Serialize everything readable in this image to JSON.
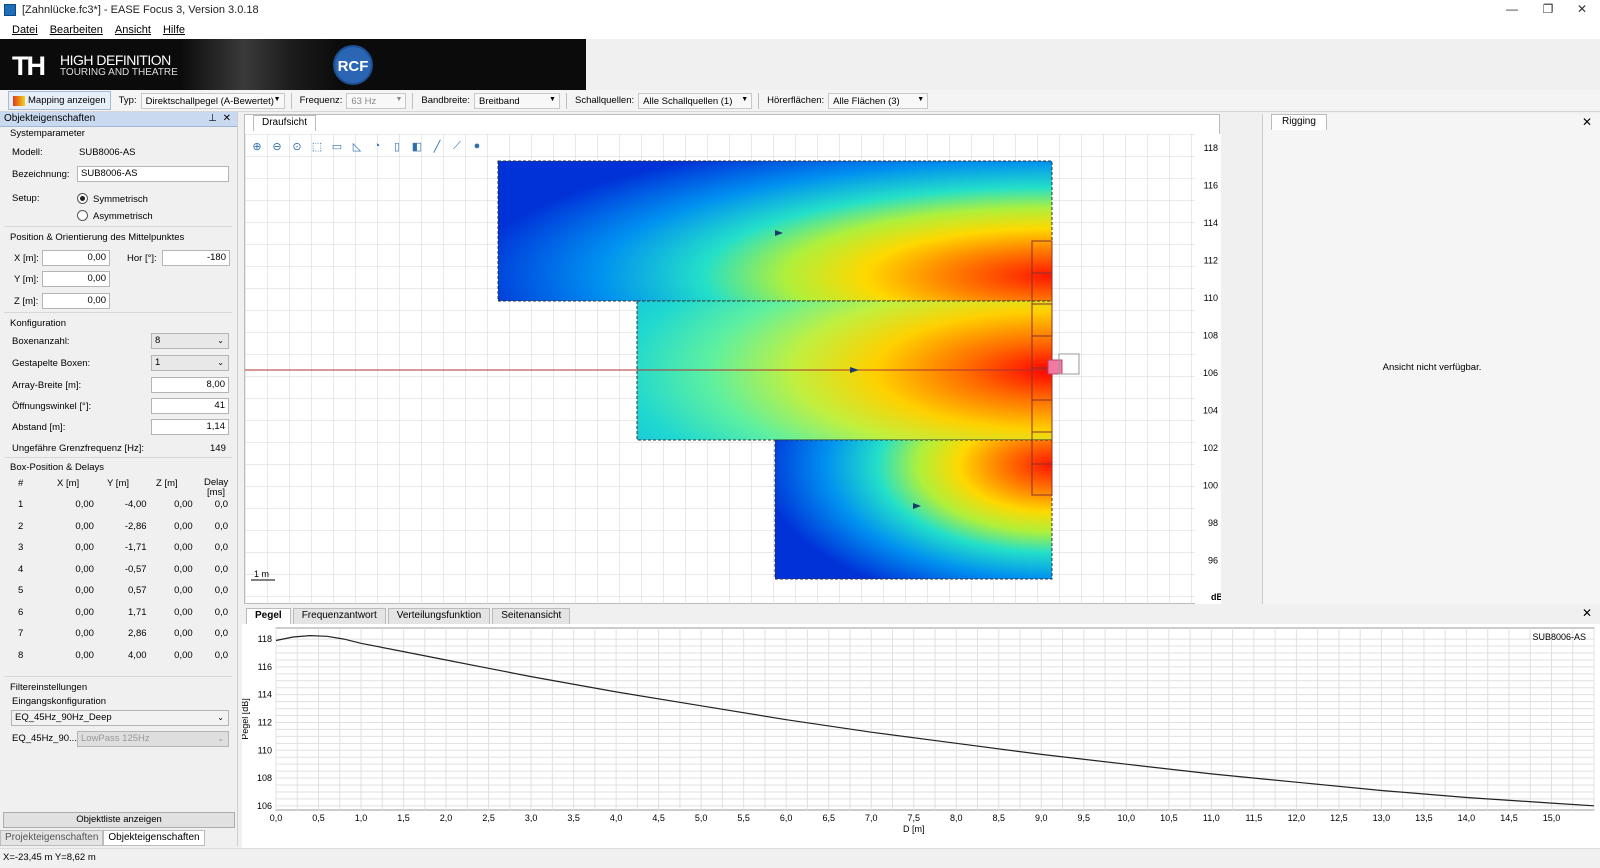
{
  "window": {
    "title": "[Zahnlücke.fc3*] - EASE Focus 3, Version 3.0.18",
    "min_symbol": "—",
    "restore_symbol": "❐",
    "close_symbol": "✕"
  },
  "menu": [
    "Datei",
    "Bearbeiten",
    "Ansicht",
    "Hilfe"
  ],
  "banner": {
    "logo_text": "TH",
    "line1": "HIGH DEFINITION",
    "line2": "TOURING AND THEATRE",
    "brand": "RCF"
  },
  "toolbar": {
    "mapping_button": "Mapping anzeigen",
    "typ_label": "Typ:",
    "typ_value": "Direktschallpegel (A-Bewertet)",
    "freq_label": "Frequenz:",
    "freq_value": "63 Hz",
    "band_label": "Bandbreite:",
    "band_value": "Breitband",
    "sources_label": "Schallquellen:",
    "sources_value": "Alle Schallquellen (1)",
    "listener_label": "Hörerflächen:",
    "listener_value": "Alle Flächen (3)"
  },
  "left_panel": {
    "header": "Objekteigenschaften",
    "pin": "⊥",
    "close": "✕",
    "sys_group": "Systemparameter",
    "model_label": "Modell:",
    "model_value": "SUB8006-AS",
    "name_label": "Bezeichnung:",
    "name_value": "SUB8006-AS",
    "setup_label": "Setup:",
    "setup_opt1": "Symmetrisch",
    "setup_opt2": "Asymmetrisch",
    "pos_group": "Position & Orientierung des Mittelpunktes",
    "x_label": "X [m]:",
    "x_value": "0,00",
    "hor_label": "Hor [°]:",
    "hor_value": "-180",
    "y_label": "Y [m]:",
    "y_value": "0,00",
    "z_label": "Z [m]:",
    "z_value": "0,00",
    "conf_group": "Konfiguration",
    "box_count_label": "Boxenanzahl:",
    "box_count_value": "8",
    "stacked_label": "Gestapelte Boxen:",
    "stacked_value": "1",
    "array_width_label": "Array-Breite [m]:",
    "array_width_value": "8,00",
    "opening_label": "Öffnungswinkel [°]:",
    "opening_value": "41",
    "spacing_label": "Abstand [m]:",
    "spacing_value": "1,14",
    "cutoff_label": "Ungefähre Grenzfrequenz [Hz]:",
    "cutoff_value": "149",
    "boxpos_group": "Box-Position & Delays",
    "table_headers": [
      "#",
      "X [m]",
      "Y [m]",
      "Z [m]",
      "Delay [ms]"
    ],
    "table_rows": [
      [
        "1",
        "0,00",
        "-4,00",
        "0,00",
        "0,0"
      ],
      [
        "2",
        "0,00",
        "-2,86",
        "0,00",
        "0,0"
      ],
      [
        "3",
        "0,00",
        "-1,71",
        "0,00",
        "0,0"
      ],
      [
        "4",
        "0,00",
        "-0,57",
        "0,00",
        "0,0"
      ],
      [
        "5",
        "0,00",
        "0,57",
        "0,00",
        "0,0"
      ],
      [
        "6",
        "0,00",
        "1,71",
        "0,00",
        "0,0"
      ],
      [
        "7",
        "0,00",
        "2,86",
        "0,00",
        "0,0"
      ],
      [
        "8",
        "0,00",
        "4,00",
        "0,00",
        "0,0"
      ]
    ],
    "filter_group": "Filtereinstellungen",
    "input_conf_label": "Eingangskonfiguration",
    "input_conf_value": "EQ_45Hz_90Hz_Deep",
    "eq_short_label": "EQ_45Hz_90...",
    "lowpass_value": "LowPass 125Hz",
    "object_list_button": "Objektliste anzeigen",
    "tab_project": "Projekteigenschaften",
    "tab_object": "Objekteigenschaften"
  },
  "draw_view": {
    "tab": "Draufsicht",
    "scale_label": "1 m",
    "colorbar_unit": "dB",
    "colorbar_ticks": [
      "118",
      "116",
      "114",
      "112",
      "110",
      "108",
      "106",
      "104",
      "102",
      "100",
      "98",
      "96"
    ],
    "tool_icons": [
      "zoom-in-icon",
      "zoom-out-icon",
      "zoom-fit-icon",
      "select-icon",
      "rect-icon",
      "polygon-icon",
      "arc-icon",
      "box-icon",
      "shape-icon",
      "line-icon",
      "measure-icon",
      "marker-icon"
    ],
    "colors": {
      "low": "#0000cc",
      "high": "#ff0000"
    }
  },
  "rigging": {
    "tab": "Rigging",
    "close": "✕",
    "message": "Ansicht nicht verfügbar."
  },
  "bottom_panel": {
    "tabs": [
      "Pegel",
      "Frequenzantwort",
      "Verteilungsfunktion",
      "Seitenansicht"
    ],
    "close": "✕"
  },
  "status": {
    "coords": "X=-23,45 m Y=8,62 m"
  },
  "chart_data": {
    "type": "line",
    "title": "",
    "xlabel": "D [m]",
    "ylabel": "Pegel [dB]",
    "xlim": [
      0,
      15.5
    ],
    "ylim": [
      105.7,
      118.8
    ],
    "xticks": [
      "0,0",
      "0,5",
      "1,0",
      "1,5",
      "2,0",
      "2,5",
      "3,0",
      "3,5",
      "4,0",
      "4,5",
      "5,0",
      "5,5",
      "6,0",
      "6,5",
      "7,0",
      "7,5",
      "8,0",
      "8,5",
      "9,0",
      "9,5",
      "10,0",
      "10,5",
      "11,0",
      "11,5",
      "12,0",
      "12,5",
      "13,0",
      "13,5",
      "14,0",
      "14,5",
      "15,0"
    ],
    "yticks": [
      "118",
      "116",
      "114",
      "112",
      "110",
      "108",
      "106"
    ],
    "grid": true,
    "series": [
      {
        "name": "SUB8006-AS",
        "x": [
          0,
          0.2,
          0.4,
          0.6,
          0.8,
          1.0,
          1.5,
          2.0,
          2.5,
          3.0,
          4.0,
          5.0,
          6.0,
          7.0,
          8.0,
          9.0,
          10.0,
          11.0,
          12.0,
          13.0,
          14.0,
          15.0,
          15.5
        ],
        "y": [
          117.9,
          118.15,
          118.25,
          118.2,
          118.0,
          117.7,
          117.1,
          116.5,
          115.9,
          115.3,
          114.2,
          113.2,
          112.2,
          111.3,
          110.5,
          109.7,
          109.0,
          108.3,
          107.7,
          107.1,
          106.6,
          106.2,
          106.0
        ]
      }
    ]
  }
}
